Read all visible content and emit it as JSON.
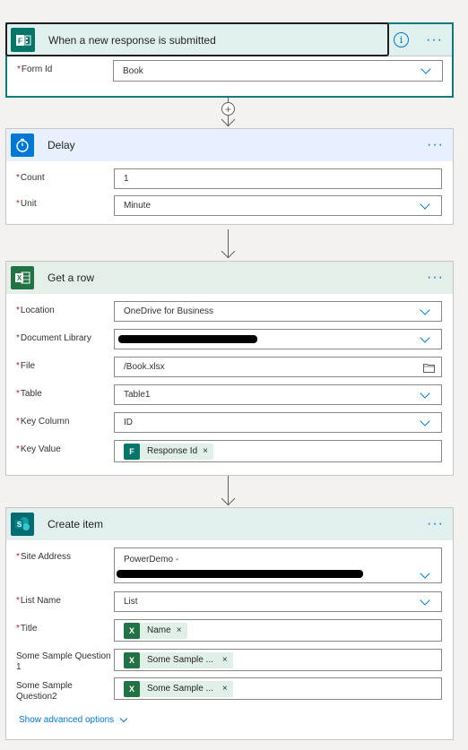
{
  "trigger": {
    "title": "When a new response is submitted",
    "icon": "forms-icon",
    "fields": [
      {
        "label": "Form Id",
        "value": "Book",
        "required": true
      }
    ]
  },
  "delay": {
    "title": "Delay",
    "icon": "timer-icon",
    "fields": [
      {
        "label": "Count",
        "value": "1",
        "required": true
      },
      {
        "label": "Unit",
        "value": "Minute",
        "required": true
      }
    ]
  },
  "get_row": {
    "title": "Get a row",
    "icon": "excel-icon",
    "fields": [
      {
        "label": "Location",
        "value": "OneDrive for Business",
        "required": true
      },
      {
        "label": "Document Library",
        "value": "",
        "required": true
      },
      {
        "label": "File",
        "value": "/Book.xlsx",
        "required": true
      },
      {
        "label": "Table",
        "value": "Table1",
        "required": true
      },
      {
        "label": "Key Column",
        "value": "ID",
        "required": true
      },
      {
        "label": "Key Value",
        "value": "",
        "required": true
      }
    ],
    "key_value_token": "Response Id"
  },
  "create_item": {
    "title": "Create item",
    "icon": "sharepoint-icon",
    "fields": [
      {
        "label": "Site Address",
        "value": "PowerDemo -",
        "required": true
      },
      {
        "label": "List Name",
        "value": "List",
        "required": true
      },
      {
        "label": "Title",
        "value": "",
        "required": true
      },
      {
        "label": "Some Sample Question 1",
        "value": "",
        "required": false
      },
      {
        "label": "Some Sample Question2",
        "value": "",
        "required": false
      }
    ],
    "tokens": {
      "title": "Name",
      "q1": "Some Sample ...",
      "q2": "Some Sample ..."
    },
    "advanced": "Show advanced options"
  },
  "menu_glyph": "···",
  "req_mark": "*",
  "remove_glyph": "×",
  "colors": {
    "accent": "#0078d4",
    "trigger_header": "#dff0ef",
    "delay_header": "#e6f0ff",
    "excel_header": "#e4efe8",
    "sharepoint_header": "#e1f0ef",
    "excel_green": "#217346",
    "forms_teal": "#077568",
    "sharepoint_teal": "#036c70"
  }
}
